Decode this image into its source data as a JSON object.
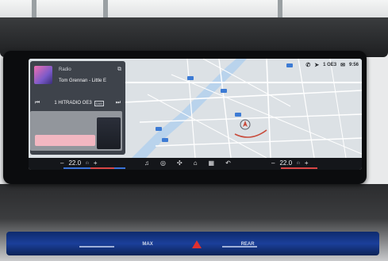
{
  "status": {
    "station_short": "1 OE3",
    "clock": "9:56"
  },
  "media": {
    "source": "Radio",
    "track": "Tom Grennan - Little E",
    "station": "1 HITRADIO OE3",
    "badge": "DAB"
  },
  "climate": {
    "left_temp": "22.0",
    "right_temp": "22.0",
    "unit": "°",
    "plus": "+",
    "minus": "–"
  },
  "quick_icons": [
    "music-icon",
    "media-icon",
    "fan-icon",
    "home-icon",
    "apps-grid-icon",
    "back-icon"
  ],
  "physical_buttons": {
    "max_label": "MAX",
    "rear_label": "REAR"
  },
  "colors": {
    "accent_blue": "#3a73d9",
    "accent_red": "#d84646",
    "route_red": "#c84a3a",
    "pink_bar": "#f2b7c1"
  }
}
